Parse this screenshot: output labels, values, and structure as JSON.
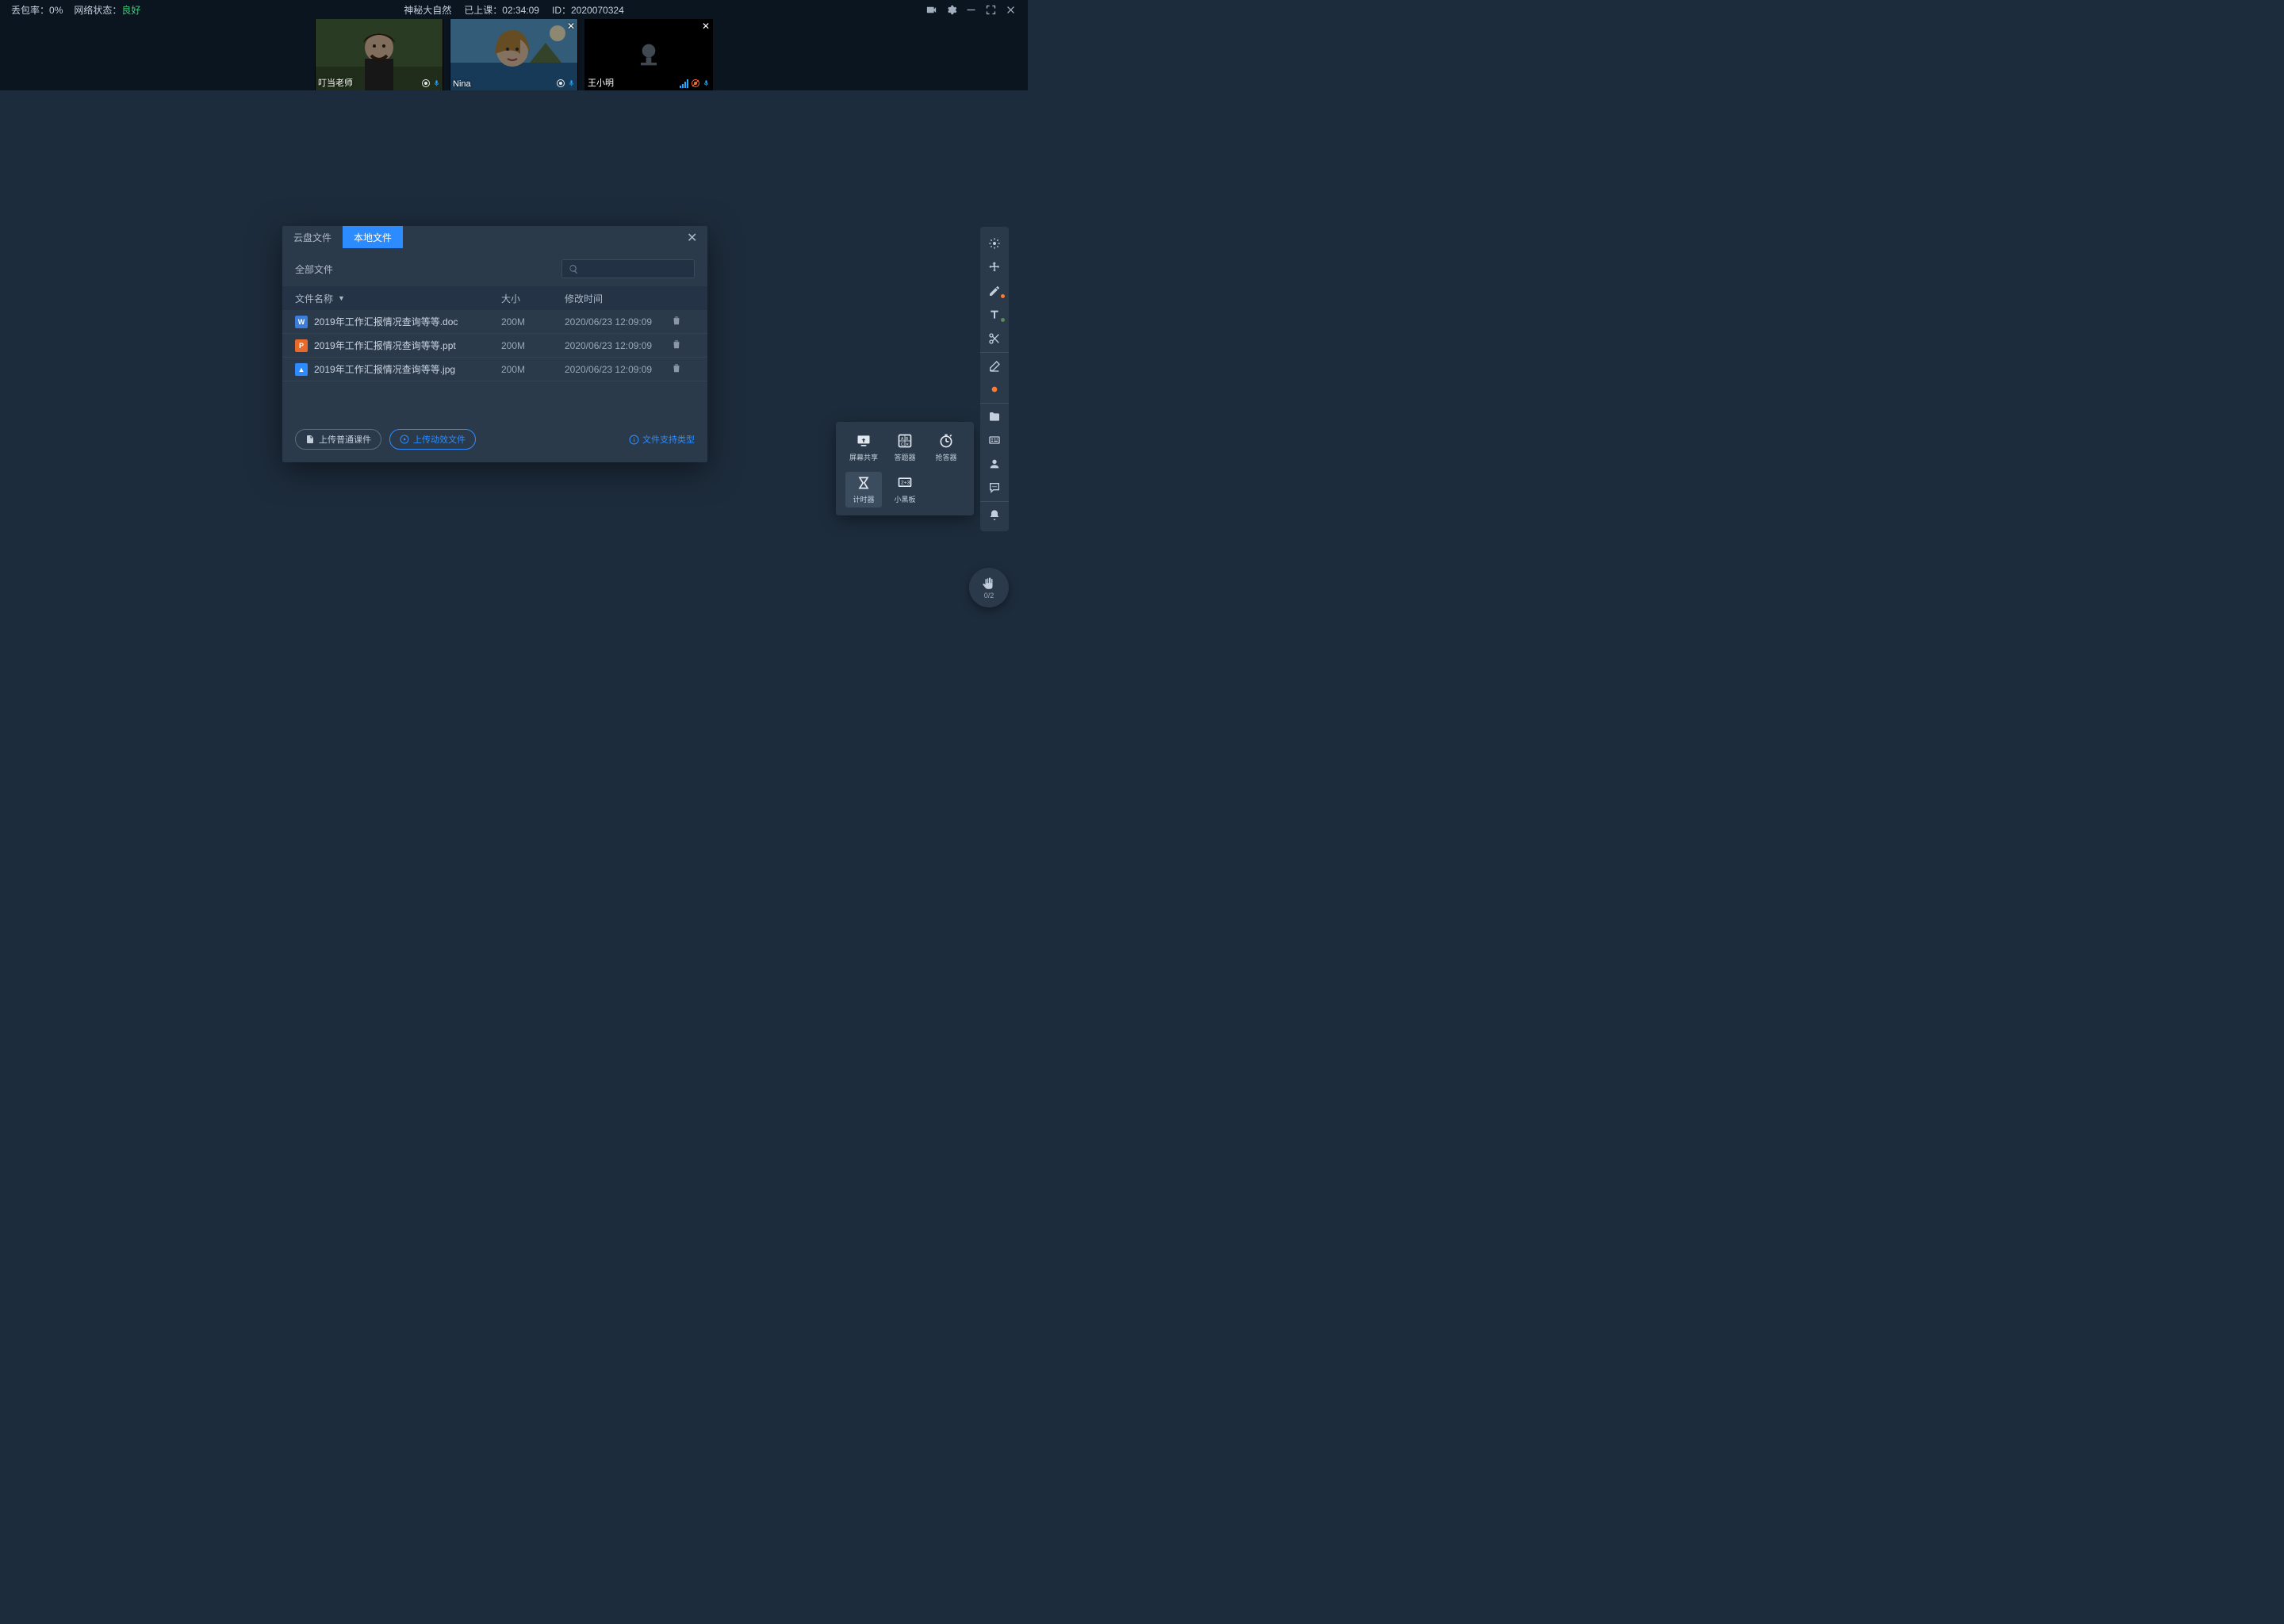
{
  "topbar": {
    "loss_label": "丢包率：",
    "loss_value": "0%",
    "net_label": "网络状态：",
    "net_value": "良好",
    "title": "神秘大自然",
    "elapsed_label": "已上课：",
    "elapsed_value": "02:34:09",
    "id_label": "ID：",
    "id_value": "2020070324"
  },
  "videos": [
    {
      "name": "叮当老师",
      "camera_off": false,
      "mic_muted": false,
      "closable": false
    },
    {
      "name": "Nina",
      "camera_off": false,
      "mic_muted": false,
      "closable": true
    },
    {
      "name": "王小明",
      "camera_off": true,
      "mic_muted": true,
      "closable": true
    }
  ],
  "modal": {
    "tab_cloud": "云盘文件",
    "tab_local": "本地文件",
    "crumb": "全部文件",
    "col_name": "文件名称",
    "col_size": "大小",
    "col_time": "修改时间",
    "rows": [
      {
        "icon": "W",
        "color": "#3b7dd8",
        "name": "2019年工作汇报情况查询等等.doc",
        "size": "200M",
        "time": "2020/06/23 12:09:09"
      },
      {
        "icon": "P",
        "color": "#e86a2b",
        "name": "2019年工作汇报情况查询等等.ppt",
        "size": "200M",
        "time": "2020/06/23 12:09:09"
      },
      {
        "icon": "▲",
        "color": "#2c8cff",
        "name": "2019年工作汇报情况查询等等.jpg",
        "size": "200M",
        "time": "2020/06/23 12:09:09"
      }
    ],
    "btn_upload_normal": "上传普通课件",
    "btn_upload_anim": "上传动效文件",
    "link_supported": "文件支持类型"
  },
  "flyout": {
    "screen_share": "屏幕共享",
    "quiz": "答题器",
    "buzzer": "抢答器",
    "timer": "计时器",
    "blackboard": "小黑板"
  },
  "hand": {
    "count": "0/2"
  }
}
